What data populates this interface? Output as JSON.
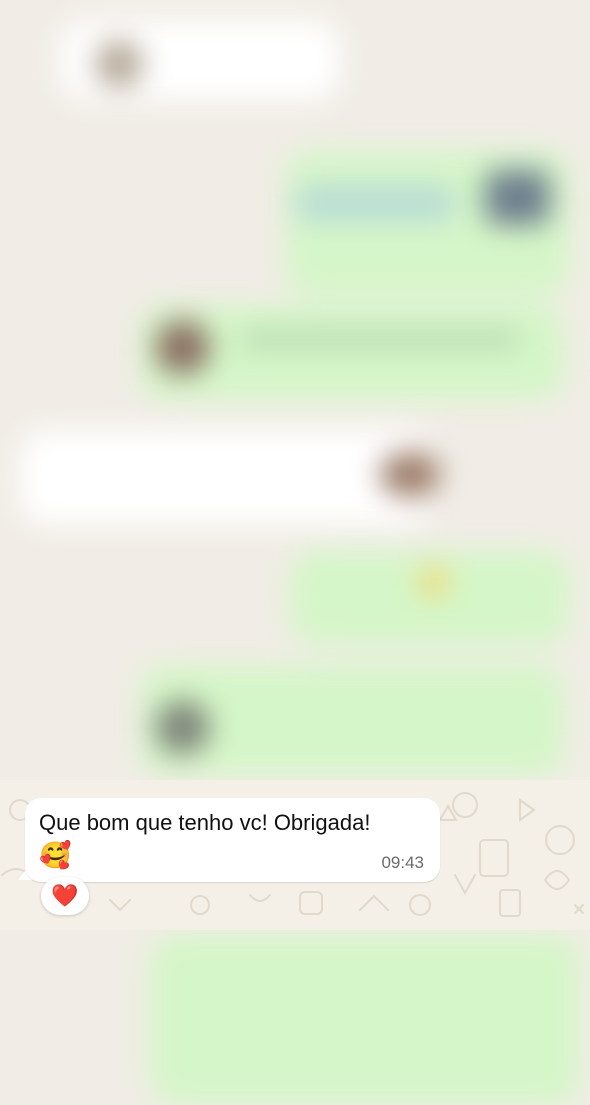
{
  "chat": {
    "message": {
      "text": "Que bom que tenho vc! Obrigada!",
      "emoji": "🥰",
      "time": "09:43",
      "reaction": "❤️"
    }
  },
  "colors": {
    "chat_background": "#f1ede6",
    "outgoing_bubble": "#d5f6c8",
    "incoming_bubble": "#ffffff",
    "timestamp": "#6b6b6b"
  },
  "icons": {
    "reaction": "heart-icon",
    "emoji": "smiling-face-with-hearts-icon"
  }
}
